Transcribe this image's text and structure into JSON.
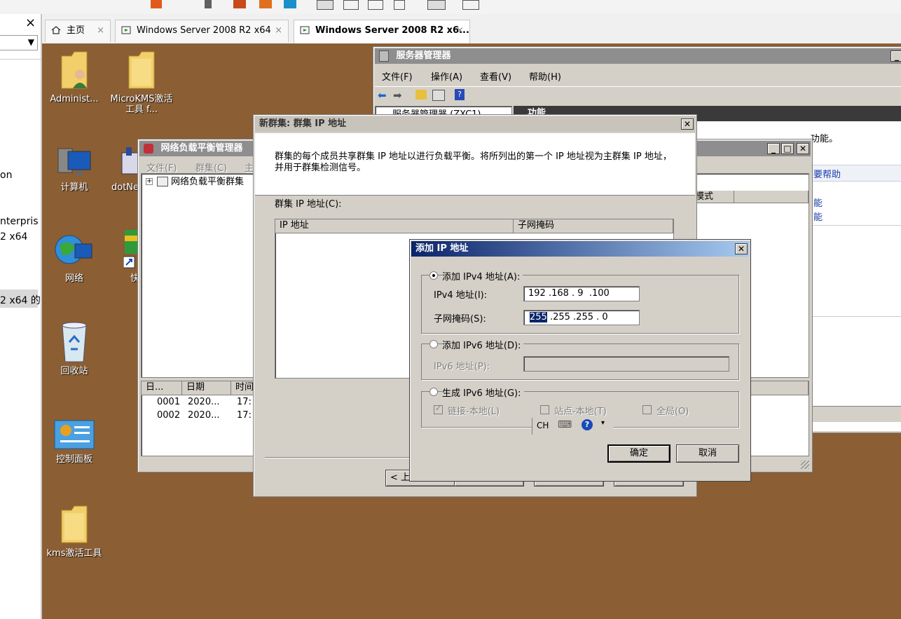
{
  "host_tabs": {
    "home": "主页",
    "vm1": "Windows Server 2008 R2 x64",
    "vm2": "Windows Server 2008 R2 x6..."
  },
  "left_panel": {
    "close": "×",
    "dropdown_arrow": "▼",
    "fragments": [
      "on",
      "nterpris",
      "2 x64",
      "2 x64 的"
    ]
  },
  "desktop_icons": {
    "administrator": "Administ...",
    "microkms": "MicroKMS激活工具 f...",
    "computer": "计算机",
    "dotnet": "dotNe",
    "network": "网络",
    "shortcut": "快",
    "recycle": "回收站",
    "control_panel": "控制面板",
    "kms_tool": "kms激活工具"
  },
  "server_manager": {
    "title": "服务器管理器",
    "menu": [
      "文件(F)",
      "操作(A)",
      "查看(V)",
      "帮助(H)"
    ],
    "tree_root": "服务器管理器 (ZXC1)",
    "panel_title": "功能",
    "text_fragment": "功能。",
    "link_help": "要帮助",
    "link_1": "能",
    "link_2": "能"
  },
  "nlb_manager": {
    "title": "网络负载平衡管理器",
    "menu": [
      "文件(F)",
      "群集(C)",
      "主"
    ],
    "tree_root": "网络负载平衡群集",
    "column_mode": "模式",
    "log_headers": [
      "日...",
      "日期",
      "时间"
    ],
    "log_rows": [
      {
        "id": "0001",
        "date": "2020...",
        "time": "17:"
      },
      {
        "id": "0002",
        "date": "2020...",
        "time": "17:"
      }
    ]
  },
  "new_cluster_dialog": {
    "title": "新群集:  群集 IP 地址",
    "description": "群集的每个成员共享群集 IP 地址以进行负载平衡。将所列出的第一个 IP 地址视为主群集 IP 地址，并用于群集检测信号。",
    "list_label": "群集 IP 地址(C):",
    "col_ip": "IP 地址",
    "col_mask": "子网掩码",
    "back_button": "< 上"
  },
  "add_ip_dialog": {
    "title": "添加 IP 地址",
    "ipv4_option": "添加 IPv4 地址(A):",
    "ipv4_label": "IPv4 地址(I):",
    "ipv4_value": "192 .168 . 9  .100",
    "mask_label": "子网掩码(S):",
    "mask_first": "255",
    "mask_rest": " .255 .255 . 0",
    "ipv6_option": "添加 IPv6 地址(D):",
    "ipv6_label": "IPv6 地址(P):",
    "gen_option": "生成 IPv6 地址(G):",
    "chk_link": "链接-本地(L)",
    "chk_site": "站点-本地(T)",
    "chk_global": "全局(O)",
    "lang_indicator": "CH",
    "ok": "确定",
    "cancel": "取消"
  },
  "colors": {
    "desktop": "#8b5e34",
    "window_face": "#d4d0c8",
    "active_title_start": "#0a246a",
    "active_title_end": "#a6caf0",
    "inactive_title": "#8e8e8e"
  }
}
